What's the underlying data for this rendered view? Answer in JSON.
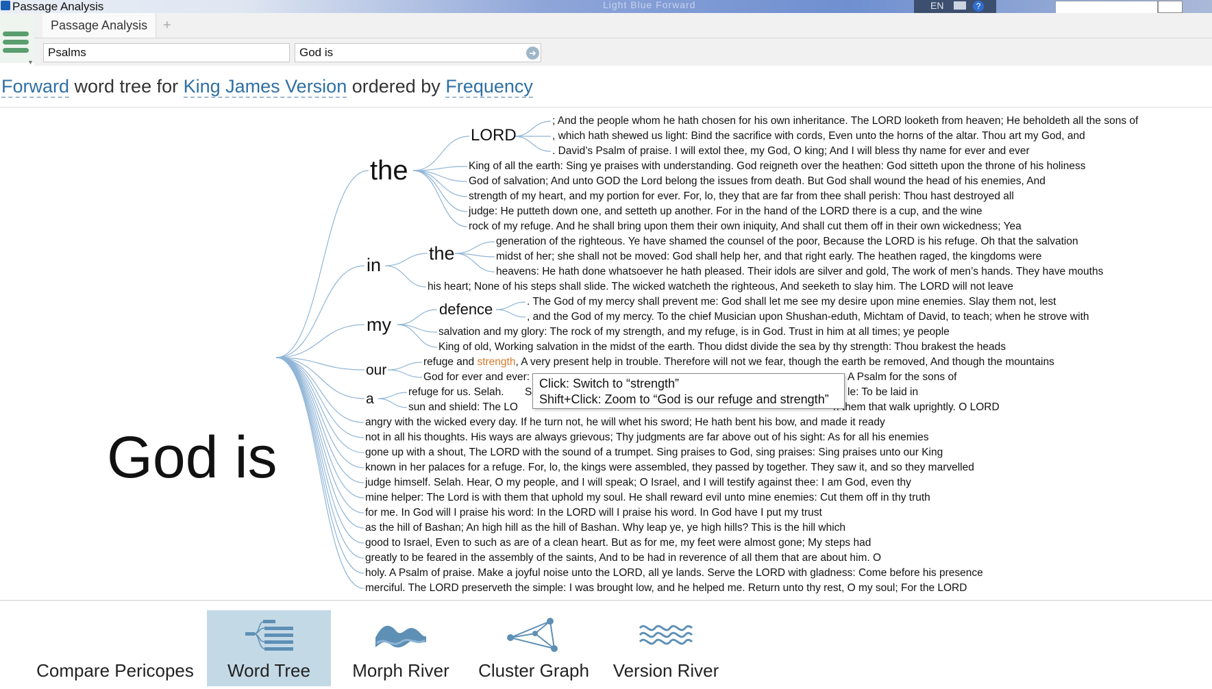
{
  "window": {
    "title": "Passage Analysis",
    "blurred_text": "Light Blue Forward",
    "lang": "EN"
  },
  "tabs": [
    {
      "label": "Passage Analysis"
    }
  ],
  "tab_add": "+",
  "inputs": {
    "reference": "Psalms",
    "query": "God is"
  },
  "heading": {
    "kw1": "Forward",
    "t1": " word tree for ",
    "kw2": "King James Version",
    "t2": " ordered by ",
    "kw3": "Frequency"
  },
  "tree": {
    "root": "God is",
    "level1": [
      "the",
      "in",
      "my",
      "our",
      "a"
    ],
    "level2": [
      "LORD",
      "the",
      "defence"
    ],
    "lines": {
      "l01": ";      And the people whom he hath chosen for his own inheritance.       The LORD looketh from heaven;       He beholdeth all the sons of",
      "l02": ", which hath shewed us light:        Bind the sacrifice with cords,       Even unto the horns of the altar.       Thou art my God, and",
      "l03": ".      David’s Psalm of praise.       I will extol thee, my God, O king;       And I will bless thy name for ever and ever",
      "l04": "King of all the earth:       Sing ye praises with understanding.       God reigneth over the heathen:       God sitteth upon the throne of his holiness",
      "l05": "God of salvation;       And unto GOD the Lord belong the issues from death.       But God shall wound the head of his enemies,       And",
      "l06": "strength of my heart, and my portion for ever.       For, lo, they that are far from thee shall perish:       Thou hast destroyed all",
      "l07": "judge:       He putteth down one, and setteth up another.       For in the hand of the LORD there is a cup, and the wine",
      "l08": "rock of my refuge.       And he shall bring upon them their own iniquity,       And shall cut them off in their own wickedness;       Yea",
      "l09": "generation of the righteous.       Ye have shamed the counsel of the poor,       Because the LORD is his refuge.       Oh that the salvation",
      "l10": "midst of her; she shall not be moved:       God shall help her, and that right early.       The heathen raged, the kingdoms were",
      "l11": "heavens:       He hath done whatsoever he hath pleased.       Their idols are silver and gold,       The work of men’s hands.       They have mouths",
      "l12": "his heart;       None of his steps shall slide.       The wicked watcheth the righteous,       And seeketh to slay him.       The LORD will not leave",
      "l13": ".       The God of my mercy shall prevent me:       God shall let me see my desire upon mine enemies.       Slay them not, lest",
      "l14": ", and the God of my mercy.       To the chief Musician upon Shushan-eduth, Michtam of David, to teach; when he strove with",
      "l15": "salvation and my glory:       The rock of my strength, and my refuge, is in God.       Trust in him at all times; ye people",
      "l16": "King of old,       Working salvation in the midst of the earth.       Thou didst divide the sea by thy strength:       Thou brakest the heads",
      "l17a": "refuge and ",
      "l17hl": "strength",
      "l17b": ",       A very present help in trouble.       Therefore will not we fear, though the earth be removed,       And though the mountains",
      "l18a": "God for ever and ever:",
      "l18b": "A Psalm for the sons of",
      "l19a": "refuge for us. Selah.",
      "l19m": "Se",
      "l19b": "le:       To be laid in",
      "l20a": "sun and shield:       The LO",
      "l20b": "h them that walk uprightly.       O LORD",
      "l21": "angry with the wicked every day.       If he turn not, he will whet his sword;       He hath bent his bow, and made it ready",
      "l22": "not in all his thoughts.       His ways are always grievous;       Thy judgments are far above out of his sight:       As for all his enemies",
      "l23": "gone up with a shout,       The LORD with the sound of a trumpet.       Sing praises to God, sing praises:       Sing praises unto our King",
      "l24": "known in her palaces for a refuge.       For, lo, the kings were assembled, they passed by together.       They saw it, and so they marvelled",
      "l25": "judge himself. Selah.       Hear, O my people, and I will speak;       O Israel, and I will testify against thee:       I am God, even thy",
      "l26": "mine helper:       The Lord is with them that uphold my soul.       He shall reward evil unto mine enemies:       Cut them off in thy truth",
      "l27": "for me.       In God will I praise his word:       In the LORD will I praise his word.       In God have I put my trust",
      "l28": "as the hill of Bashan;       An high hill as the hill of Bashan.       Why leap ye, ye high hills?       This is the hill which",
      "l29": "good to Israel,       Even to such as are of a clean heart.       But as for me, my feet were almost gone;       My steps had",
      "l30": "greatly to be feared in the assembly of the saints,       And to be had in reverence of all them that are about him.       O",
      "l31": "holy.       A Psalm of praise.       Make a joyful noise unto the LORD, all ye lands.       Serve the LORD with gladness:       Come before his presence",
      "l32": "merciful.       The LORD preserveth the simple:       I was brought low, and he helped me.       Return unto thy rest, O my soul;       For the LORD"
    }
  },
  "tooltip": {
    "line1": "Click: Switch to “strength”",
    "line2": "Shift+Click: Zoom to “God is our refuge and strength”"
  },
  "visualizations": [
    {
      "label": "Compare Pericopes",
      "icon": "grid-icon"
    },
    {
      "label": "Word Tree",
      "icon": "word-tree-icon",
      "active": true
    },
    {
      "label": "Morph River",
      "icon": "morph-river-icon"
    },
    {
      "label": "Cluster Graph",
      "icon": "cluster-graph-icon"
    },
    {
      "label": "Version River",
      "icon": "version-river-icon"
    }
  ],
  "colors": {
    "keyword": "#2e6fa4",
    "highlight": "#d7792a",
    "branch": "#8fb4d6",
    "active_tab": "#c4d9e6",
    "icon_blue": "#5e8fb5"
  }
}
